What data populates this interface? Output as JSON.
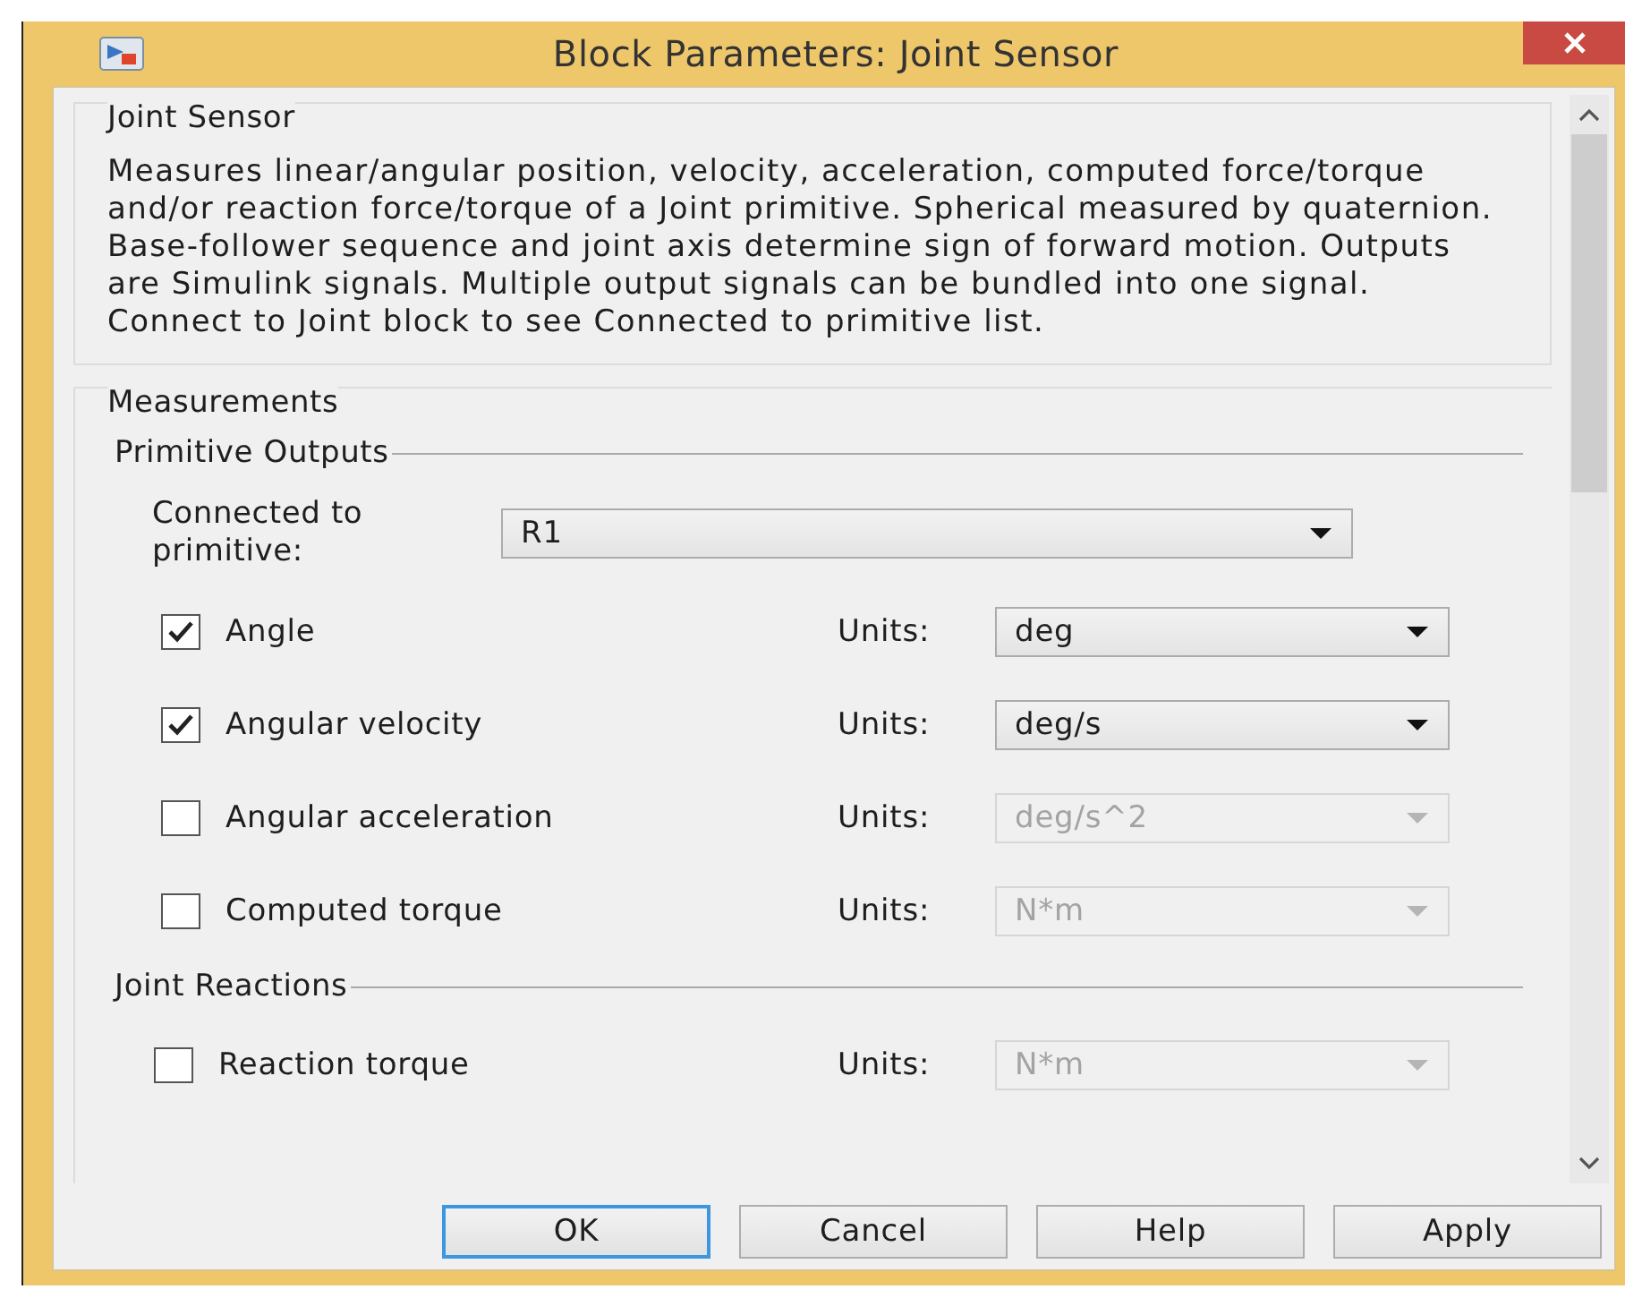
{
  "window": {
    "title": "Block Parameters: Joint Sensor"
  },
  "description_group": {
    "title": "Joint Sensor",
    "text": "Measures linear/angular position, velocity, acceleration, computed force/torque and/or reaction force/torque of a Joint primitive. Spherical measured by quaternion. Base-follower sequence and joint axis determine sign of forward motion. Outputs are Simulink signals. Multiple output signals can be bundled into one signal. Connect to Joint block to see Connected to primitive list."
  },
  "measurements": {
    "title": "Measurements",
    "sections": [
      {
        "title": "Primitive Outputs",
        "primitive": {
          "label": "Connected to primitive:",
          "value": "R1"
        },
        "rows": [
          {
            "label": "Angle",
            "checked": true,
            "units_label": "Units:",
            "units": "deg",
            "disabled": false
          },
          {
            "label": "Angular velocity",
            "checked": true,
            "units_label": "Units:",
            "units": "deg/s",
            "disabled": false
          },
          {
            "label": "Angular acceleration",
            "checked": false,
            "units_label": "Units:",
            "units": "deg/s^2",
            "disabled": true
          },
          {
            "label": "Computed torque",
            "checked": false,
            "units_label": "Units:",
            "units": "N*m",
            "disabled": true
          }
        ]
      },
      {
        "title": "Joint Reactions",
        "rows": [
          {
            "label": "Reaction torque",
            "checked": false,
            "units_label": "Units:",
            "units": "N*m",
            "disabled": true
          }
        ]
      }
    ]
  },
  "buttons": [
    {
      "label": "OK",
      "focused": true
    },
    {
      "label": "Cancel",
      "focused": false
    },
    {
      "label": "Help",
      "focused": false
    },
    {
      "label": "Apply",
      "focused": false
    }
  ]
}
